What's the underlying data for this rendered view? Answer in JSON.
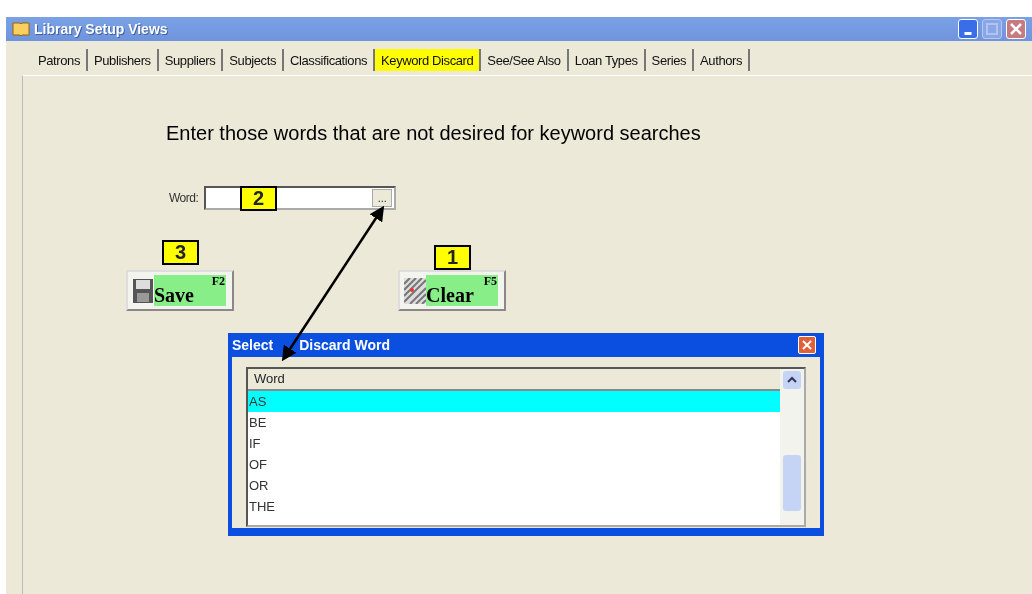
{
  "window": {
    "title": "Library Setup Views"
  },
  "tabs": [
    {
      "label": "Patrons",
      "selected": false
    },
    {
      "label": "Publishers",
      "selected": false
    },
    {
      "label": "Suppliers",
      "selected": false
    },
    {
      "label": "Subjects",
      "selected": false
    },
    {
      "label": "Classifications",
      "selected": false
    },
    {
      "label": "Keyword Discard",
      "selected": true
    },
    {
      "label": "See/See Also",
      "selected": false
    },
    {
      "label": "Loan Types",
      "selected": false
    },
    {
      "label": "Series",
      "selected": false
    },
    {
      "label": "Authors",
      "selected": false
    }
  ],
  "heading": "Enter those words that are not desired for keyword searches",
  "word_field": {
    "label": "Word:",
    "browse": "..."
  },
  "buttons": [
    {
      "kind": "save",
      "label": "Save",
      "shortcut": "F2"
    },
    {
      "kind": "clear",
      "label": "Clear",
      "shortcut": "F5"
    }
  ],
  "callouts": [
    "2",
    "3",
    "1"
  ],
  "dialog": {
    "title_parts": [
      "Select",
      "Discard Word"
    ],
    "column": "Word",
    "rows": [
      {
        "word": "AS",
        "selected": true
      },
      {
        "word": "BE",
        "selected": false
      },
      {
        "word": "IF",
        "selected": false
      },
      {
        "word": "OF",
        "selected": false
      },
      {
        "word": "OR",
        "selected": false
      },
      {
        "word": "THE",
        "selected": false
      }
    ]
  }
}
